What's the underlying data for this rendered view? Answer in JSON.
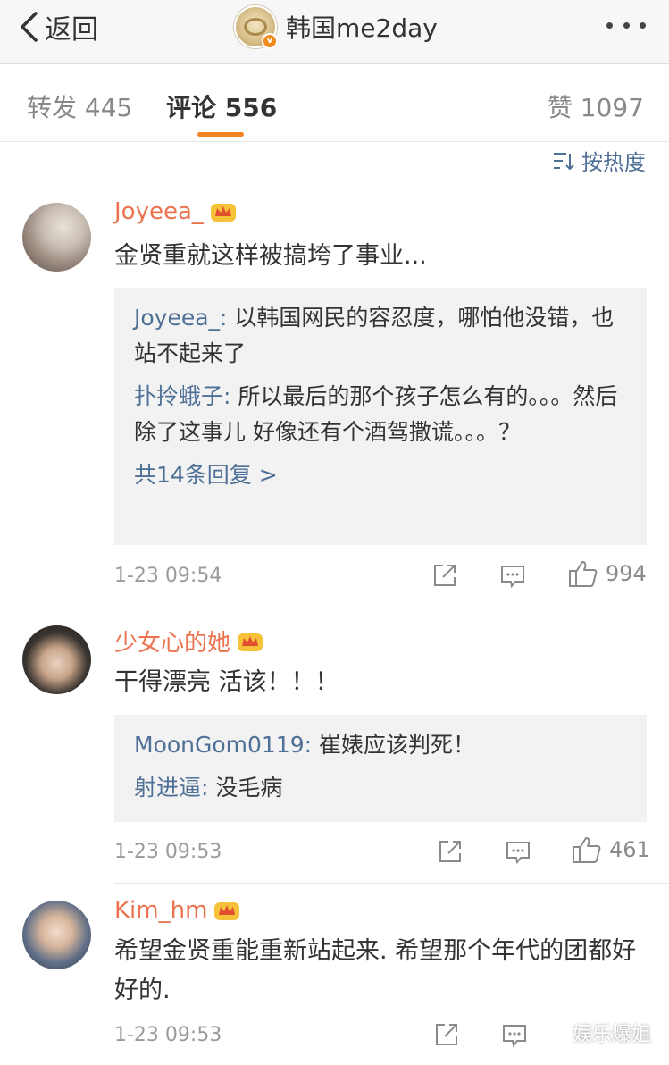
{
  "nav": {
    "back_label": "返回",
    "title": "韩国me2day"
  },
  "tabs": {
    "repost": "转发 445",
    "comments": "评论 556",
    "likes": "赞 1097"
  },
  "sort": {
    "label": "按热度"
  },
  "comments": [
    {
      "user": "Joyeea_",
      "text": "金贤重就这样被搞垮了事业...",
      "replies": [
        {
          "user": "Joyeea_:",
          "text": " 以韩国网民的容忍度，哪怕他没错，也站不起来了"
        },
        {
          "user": "扑拎蛾子:",
          "text": " 所以最后的那个孩子怎么有的。。。然后除了这事儿 好像还有个酒驾撒谎。。。？"
        }
      ],
      "more_replies": "共14条回复 >",
      "time": "1-23 09:54",
      "likes": "994"
    },
    {
      "user": "少女心的她",
      "text": "干得漂亮 活该！！！",
      "replies": [
        {
          "user": "MoonGom0119:",
          "text": " 崔婊应该判死！"
        },
        {
          "user": "射进逼:",
          "text": " 没毛病"
        }
      ],
      "time": "1-23 09:53",
      "likes": "461"
    },
    {
      "user": "Kim_hm",
      "text": "希望金贤重能重新站起来.   希望那个年代的团都好好的.",
      "time": "1-23 09:53"
    }
  ],
  "watermark": "娱乐爆姐",
  "colors": {
    "accent": "#f58220",
    "username": "#eb7350",
    "link": "#4e6f96",
    "reply_bg": "#f2f2f2",
    "navbar_bg": "#f7f7f7"
  }
}
